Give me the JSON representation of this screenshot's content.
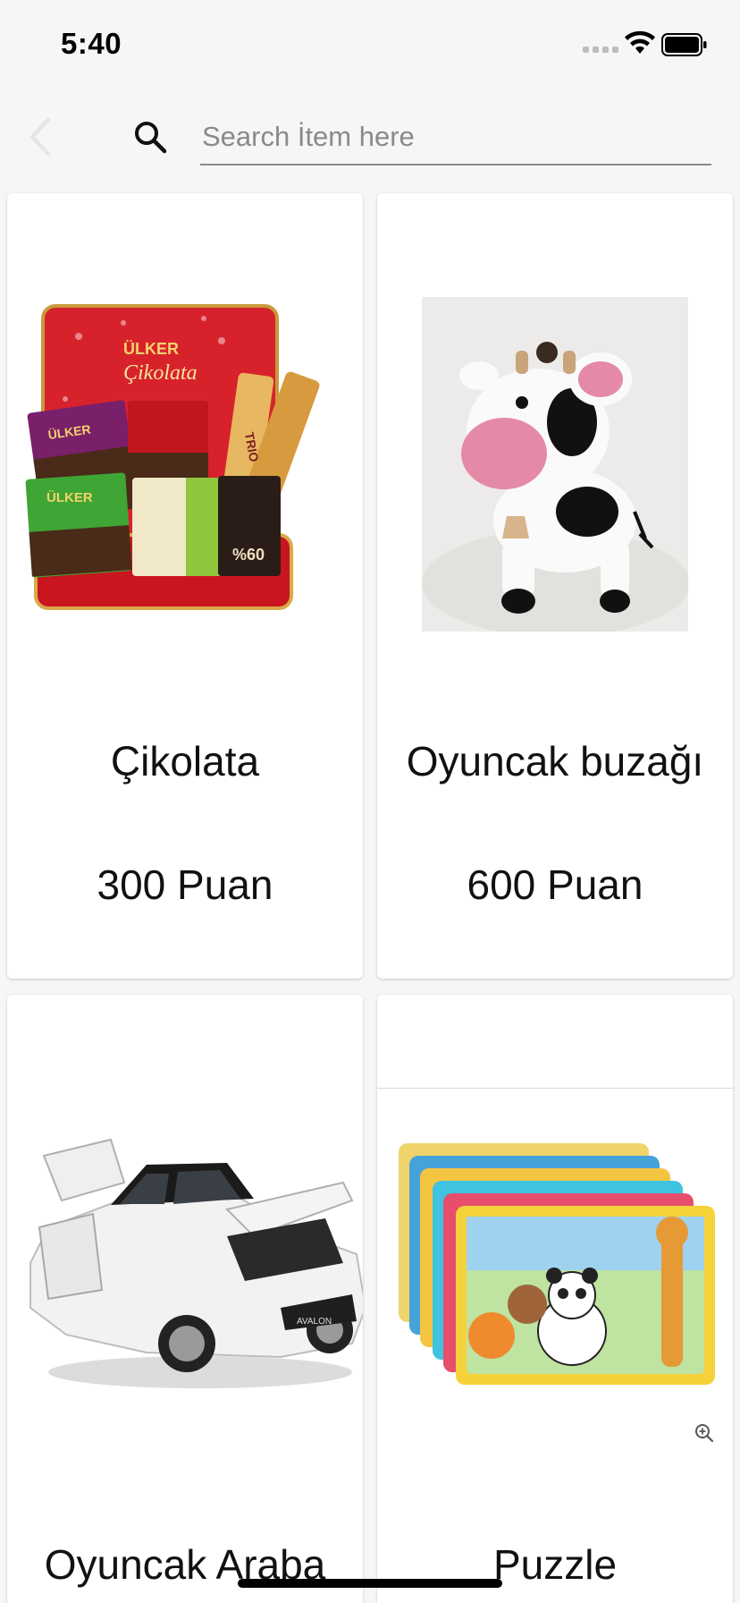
{
  "status_bar": {
    "time": "5:40"
  },
  "search": {
    "placeholder": "Search İtem here",
    "value": ""
  },
  "products": [
    {
      "name": "Çikolata",
      "price": "300 Puan"
    },
    {
      "name": "Oyuncak buzağı",
      "price": "600 Puan"
    },
    {
      "name": "Oyuncak Araba",
      "price": ""
    },
    {
      "name": "Puzzle",
      "price": ""
    }
  ],
  "colors": {
    "background": "#f6f6f6",
    "card": "#ffffff",
    "back_icon": "#e6e6e6"
  },
  "icons": [
    "chevron-left-icon",
    "search-icon",
    "wifi-icon",
    "battery-icon",
    "zoom-in-icon"
  ]
}
